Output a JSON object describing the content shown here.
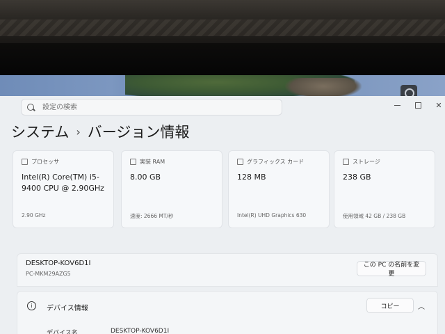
{
  "search": {
    "placeholder": "設定の検索"
  },
  "breadcrumb": {
    "parent": "システム",
    "separator": "›",
    "current": "バージョン情報"
  },
  "cards": [
    {
      "icon": "processor-icon",
      "title": "プロセッサ",
      "value": "Intel(R) Core(TM) i5-9400 CPU @ 2.90GHz",
      "sub": "2.90 GHz"
    },
    {
      "icon": "ram-icon",
      "title": "実装 RAM",
      "value": "8.00 GB",
      "sub": "速度: 2666 MT/秒"
    },
    {
      "icon": "graphics-card-icon",
      "title": "グラフィックス カード",
      "value": "128 MB",
      "sub": "Intel(R) UHD Graphics 630"
    },
    {
      "icon": "storage-icon",
      "title": "ストレージ",
      "value": "238 GB",
      "sub": "使用領域 42 GB / 238 GB"
    }
  ],
  "device": {
    "name": "DESKTOP-KOV6D1I",
    "model": "PC-MKM29AZG5",
    "rename_label": "この PC の名前を変更"
  },
  "device_info": {
    "title": "デバイス情報",
    "copy_label": "コピー",
    "row_key": "デバイス名",
    "row_value": "DESKTOP-KOV6D1I"
  }
}
